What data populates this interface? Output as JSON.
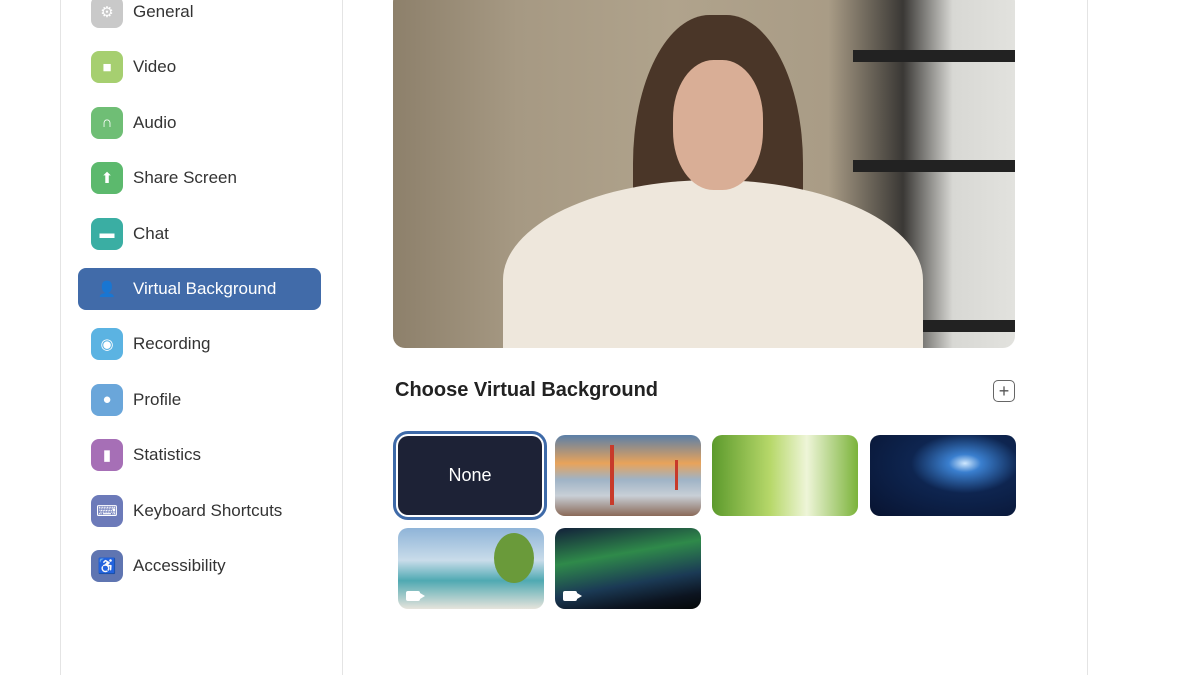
{
  "sidebar": {
    "items": [
      {
        "label": "General",
        "icon": "gear-icon",
        "color": "#c9c9c9",
        "glyph": "⚙"
      },
      {
        "label": "Video",
        "icon": "video-camera-icon",
        "color": "#a6cf70",
        "glyph": "■"
      },
      {
        "label": "Audio",
        "icon": "headphones-icon",
        "color": "#6fbe75",
        "glyph": "∩"
      },
      {
        "label": "Share Screen",
        "icon": "share-screen-icon",
        "color": "#5cb96d",
        "glyph": "⬆"
      },
      {
        "label": "Chat",
        "icon": "chat-icon",
        "color": "#3aaea3",
        "glyph": "▬"
      },
      {
        "label": "Virtual Background",
        "icon": "virtual-background-icon",
        "color": "#416ba9",
        "glyph": "👤",
        "selected": true
      },
      {
        "label": "Recording",
        "icon": "recording-icon",
        "color": "#5bb3e2",
        "glyph": "◉"
      },
      {
        "label": "Profile",
        "icon": "profile-icon",
        "color": "#6aa6da",
        "glyph": "●"
      },
      {
        "label": "Statistics",
        "icon": "statistics-icon",
        "color": "#a66fb6",
        "glyph": "▮"
      },
      {
        "label": "Keyboard Shortcuts",
        "icon": "keyboard-icon",
        "color": "#6c7ab9",
        "glyph": "⌨"
      },
      {
        "label": "Accessibility",
        "icon": "accessibility-icon",
        "color": "#5f75b1",
        "glyph": "♿"
      }
    ]
  },
  "main": {
    "section_title": "Choose Virtual Background",
    "add_glyph": "+",
    "backgrounds": [
      {
        "label": "None",
        "selected": true
      },
      {
        "name": "golden-gate-bridge"
      },
      {
        "name": "grass"
      },
      {
        "name": "earth-from-space"
      },
      {
        "name": "beach-palm",
        "video": true
      },
      {
        "name": "aurora",
        "video": true
      }
    ]
  }
}
